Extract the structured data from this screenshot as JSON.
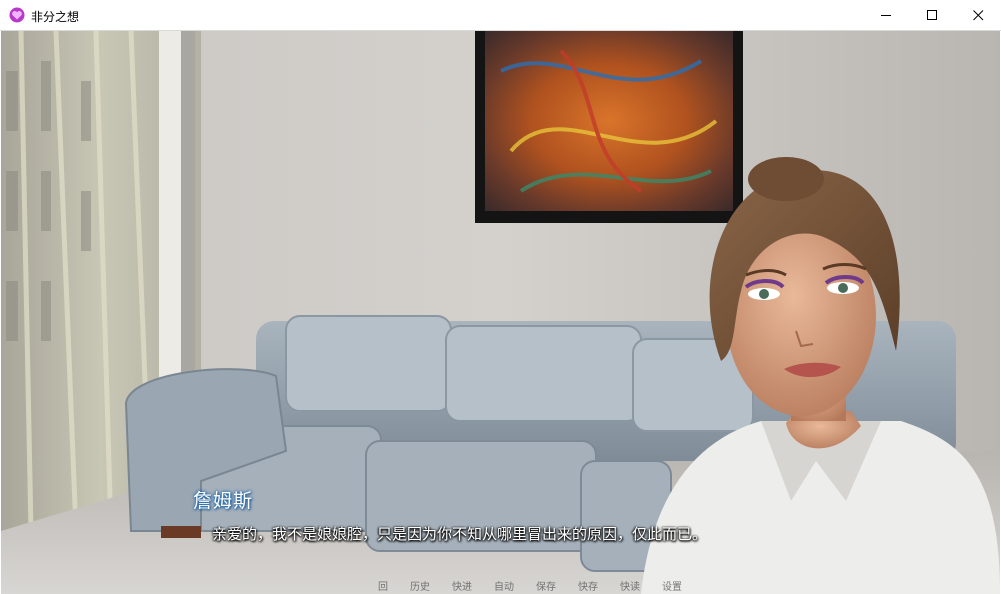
{
  "window": {
    "title": "非分之想",
    "icon": "heart-icon",
    "controls": [
      "minimize-icon",
      "maximize-icon",
      "close-icon"
    ]
  },
  "dialogue": {
    "speaker": "詹姆斯",
    "text": "亲爱的，我不是娘娘腔，只是因为你不知从哪里冒出来的原因，仅此而已。"
  },
  "quick_menu": {
    "items": [
      "回",
      "历史",
      "快进",
      "自动",
      "保存",
      "快存",
      "快读",
      "设置"
    ]
  },
  "colors": {
    "accent": "#b838c9",
    "speaker_glow": "#2a6fb0"
  }
}
